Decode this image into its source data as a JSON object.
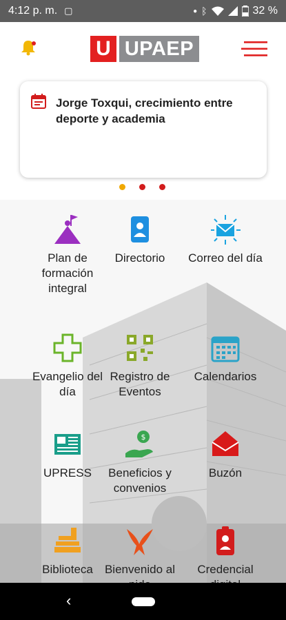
{
  "status": {
    "time": "4:12 p. m.",
    "battery": "32 %"
  },
  "header": {
    "logo_letter": "U",
    "logo_name": "UPAEP"
  },
  "news": {
    "title": "Jorge Toxqui, crecimiento entre deporte y academia"
  },
  "carousel": {
    "dot_colors": [
      "#f0a800",
      "#d21c1c",
      "#d21c1c"
    ]
  },
  "menu_items": [
    {
      "label_lines": [
        "Plan de",
        "formación",
        "integral"
      ],
      "icon": "mountain-flag-icon",
      "color": "#9b2fc0"
    },
    {
      "label_lines": [
        "Directorio"
      ],
      "icon": "contacts-book-icon",
      "color": "#1e8fe0"
    },
    {
      "label_lines": [
        "Correo del día"
      ],
      "icon": "envelope-burst-icon",
      "color": "#1aa3e0"
    },
    {
      "label_lines": [
        "Evangelio del",
        "día"
      ],
      "icon": "cross-icon",
      "color": "#6bb42a"
    },
    {
      "label_lines": [
        "Registro de",
        "Eventos"
      ],
      "icon": "qr-code-icon",
      "color": "#8aa82a"
    },
    {
      "label_lines": [
        "Calendarios"
      ],
      "icon": "calendar-icon",
      "color": "#2aa3c8"
    },
    {
      "label_lines": [
        "UPRESS"
      ],
      "icon": "newspaper-icon",
      "color": "#1a9e8a"
    },
    {
      "label_lines": [
        "Beneficios y",
        "convenios"
      ],
      "icon": "hand-coin-icon",
      "color": "#3aa650"
    },
    {
      "label_lines": [
        "Buzón"
      ],
      "icon": "mailbox-envelope-icon",
      "color": "#d81a1a"
    },
    {
      "label_lines": [
        "Biblioteca"
      ],
      "icon": "books-icon",
      "color": "#f0a020"
    },
    {
      "label_lines": [
        "Bienvenido al",
        "nido"
      ],
      "icon": "eagle-icon",
      "color": "#e8501a"
    },
    {
      "label_lines": [
        "Credencial",
        "digital"
      ],
      "icon": "id-badge-icon",
      "color": "#d21c1c"
    }
  ]
}
